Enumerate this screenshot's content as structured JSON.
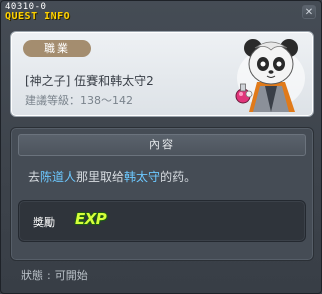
{
  "window": {
    "quest_id": "40310-0",
    "title": "QUEST INFO",
    "close_symbol": "✕"
  },
  "header": {
    "badge": "職業",
    "quest_name": "[神之子] 伍賽和韩太守2",
    "level_label": "建議等級：138～142"
  },
  "content": {
    "section_title": "內容",
    "desc": {
      "prefix": "去",
      "npc1": "陈道人",
      "middle": "那里取给",
      "npc2": "韩太守",
      "suffix": "的药。"
    },
    "reward": {
      "label": "獎勵",
      "exp_text": "EXP"
    }
  },
  "footer": {
    "status_label": "狀態",
    "status_value": "可開始"
  },
  "colors": {
    "title_yellow": "#ffd200",
    "npc_highlight": "#6cc8ff",
    "badge_brown": "#a48d6f",
    "exp_green": "#d6ff3a"
  }
}
